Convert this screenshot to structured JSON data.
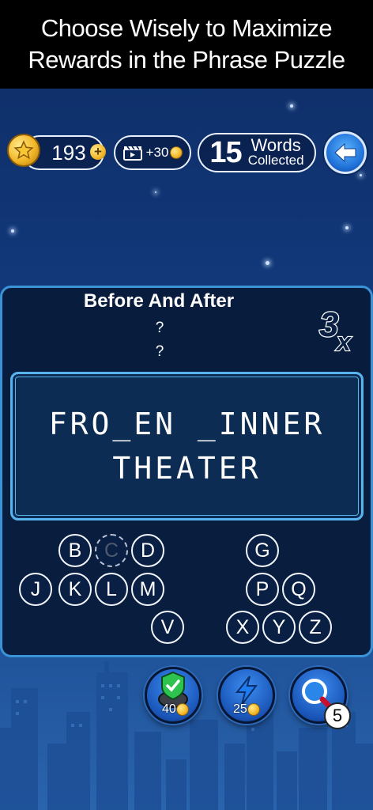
{
  "banner": {
    "line1": "Choose Wisely to Maximize",
    "line2": "Rewards in the Phrase Puzzle"
  },
  "hud": {
    "coins": "193",
    "coin_plus": "+",
    "video_reward": "+30",
    "words_count": "15",
    "words_label_top": "Words",
    "words_label_bottom": "Collected"
  },
  "puzzle": {
    "category": "Before And After",
    "hint1": "?",
    "hint2": "?",
    "multiplier": "3x",
    "phrase_line1": "FRO_EN _INNER",
    "phrase_line2": "THEATER"
  },
  "letters": {
    "B": "B",
    "C": "C",
    "D": "D",
    "G": "G",
    "J": "J",
    "K": "K",
    "L": "L",
    "M": "M",
    "P": "P",
    "Q": "Q",
    "V": "V",
    "X": "X",
    "Y": "Y",
    "Z": "Z"
  },
  "powerups": {
    "reveal_cost": "40",
    "bolt_cost": "25",
    "hint_count": "5"
  },
  "colors": {
    "panel_border": "#3a93d6",
    "coin_gold": "#f2b728",
    "accent_blue": "#1e6fd6"
  }
}
